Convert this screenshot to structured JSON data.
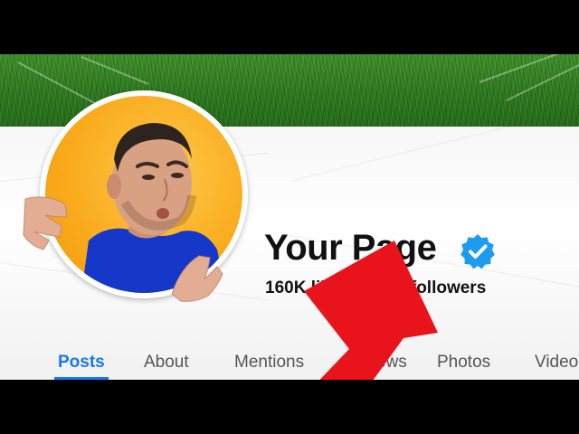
{
  "page": {
    "name": "Your Page",
    "stats": "160K likes • 169K followers",
    "verified_icon": "verified-check-icon"
  },
  "tabs": [
    {
      "label": "Posts",
      "active": true
    },
    {
      "label": "About",
      "active": false
    },
    {
      "label": "Mentions",
      "active": false
    },
    {
      "label": "Reviews",
      "active": false
    },
    {
      "label": "Photos",
      "active": false
    },
    {
      "label": "Videos",
      "active": false
    }
  ],
  "colors": {
    "accent": "#1877f2",
    "verified": "#1d9bf0",
    "arrow": "#e8131b",
    "avatar_bg": "#f9a91a"
  }
}
